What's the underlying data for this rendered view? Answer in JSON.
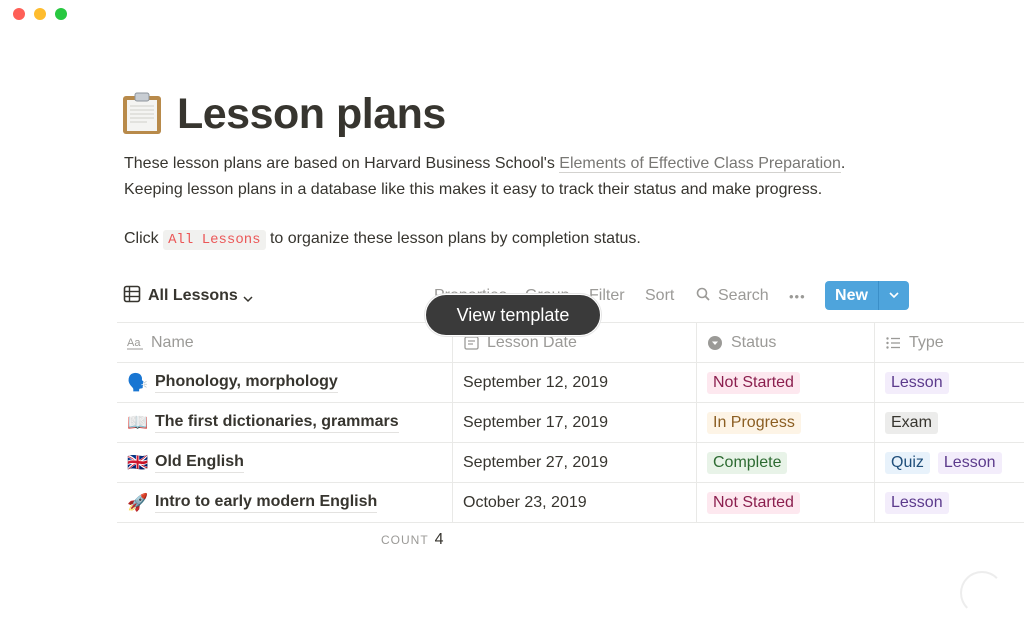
{
  "window": {
    "controls": [
      "close",
      "minimize",
      "zoom"
    ]
  },
  "page": {
    "icon": "clipboard-icon",
    "title": "Lesson plans",
    "description": {
      "line1_prefix": "These lesson plans are based on Harvard Business School's ",
      "line1_link": "Elements of Effective Class Preparation",
      "line1_suffix": ".",
      "line2": "Keeping lesson plans in a database like this makes it easy to track their status and make progress."
    },
    "instruction": {
      "prefix": "Click ",
      "code": "All Lessons",
      "suffix": " to organize these lesson plans by completion status."
    }
  },
  "database": {
    "view_name": "All Lessons",
    "view_icon": "table-icon",
    "toolbar": {
      "properties": "Properties",
      "group": "Group",
      "filter": "Filter",
      "sort": "Sort",
      "search": "Search",
      "more": "•••",
      "new_label": "New"
    },
    "columns": [
      {
        "label": "Name",
        "icon": "text-aa-icon"
      },
      {
        "label": "Lesson Date",
        "icon": "date-icon"
      },
      {
        "label": "Status",
        "icon": "select-icon"
      },
      {
        "label": "Type",
        "icon": "multi-select-icon"
      }
    ],
    "rows": [
      {
        "emoji": "🗣️",
        "name": "Phonology, morphology",
        "date": "September 12, 2019",
        "status": "Not Started",
        "types": [
          "Lesson"
        ]
      },
      {
        "emoji": "📖",
        "name": "The first dictionaries, grammars",
        "date": "September 17, 2019",
        "status": "In Progress",
        "types": [
          "Exam"
        ]
      },
      {
        "emoji": "🇬🇧",
        "name": "Old English",
        "date": "September 27, 2019",
        "status": "Complete",
        "types": [
          "Quiz",
          "Lesson"
        ]
      },
      {
        "emoji": "🚀",
        "name": "Intro to early modern English",
        "date": "October 23, 2019",
        "status": "Not Started",
        "types": [
          "Lesson"
        ]
      }
    ],
    "count_label": "COUNT",
    "count_value": "4"
  },
  "overlay": {
    "tooltip": "View template"
  },
  "colors": {
    "accent": "#4ea4dc",
    "not_started": "#fde8ef",
    "in_progress": "#fdf4e6",
    "complete": "#e8f3e8"
  }
}
